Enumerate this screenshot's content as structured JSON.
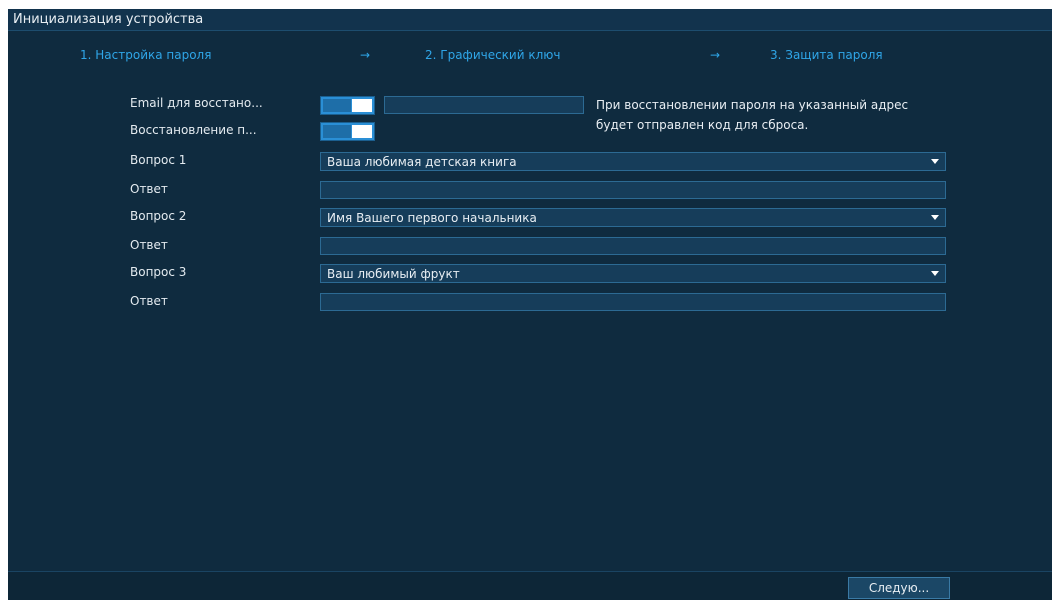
{
  "window": {
    "title": "Инициализация устройства"
  },
  "steps": [
    {
      "label": "1.  Настройка пароля",
      "state": "current"
    },
    {
      "label": "2.  Графический ключ",
      "state": "next"
    },
    {
      "label": "3.  Защита пароля",
      "state": "next"
    }
  ],
  "step_arrow": "→",
  "form": {
    "email_label": "Email для восстано...",
    "email_toggle": "on",
    "email_value": "",
    "email_hint_line1": "При восстановлении пароля на указанный адрес",
    "email_hint_line2": "будет отправлен код для сброса.",
    "recovery_label": "Восстановление п...",
    "recovery_toggle": "on",
    "questions": [
      {
        "label": "Вопрос 1",
        "selected": "Ваша любимая детская книга",
        "answer_label": "Ответ",
        "answer_value": ""
      },
      {
        "label": "Вопрос 2",
        "selected": "Имя Вашего первого начальника",
        "answer_label": "Ответ",
        "answer_value": ""
      },
      {
        "label": "Вопрос 3",
        "selected": "Ваш любимый фрукт",
        "answer_label": "Ответ",
        "answer_value": ""
      }
    ]
  },
  "footer": {
    "next_label": "Следую..."
  },
  "colors": {
    "background": "#0f2b3f",
    "accent": "#2fa6e8",
    "toggle_on": "#2a8fd6"
  }
}
